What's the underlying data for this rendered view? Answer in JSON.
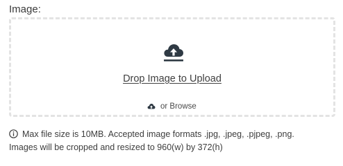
{
  "field": {
    "label": "Image:"
  },
  "dropzone": {
    "icon": "cloud-upload-icon",
    "primary_text": "Drop Image to Upload",
    "browse_icon": "small-cloud-upload-icon",
    "browse_text": "or Browse"
  },
  "note": {
    "icon": "info-icon",
    "line1": "Max file size is 10MB. Accepted image formats .jpg, .jpeg, .pjpeg, .png.",
    "line2": "Images will be cropped and resized to 960(w) by 372(h)"
  },
  "colors": {
    "text": "#3d3d3d",
    "dashed_border": "#e3e3e3",
    "icon": "#2f3a44"
  }
}
